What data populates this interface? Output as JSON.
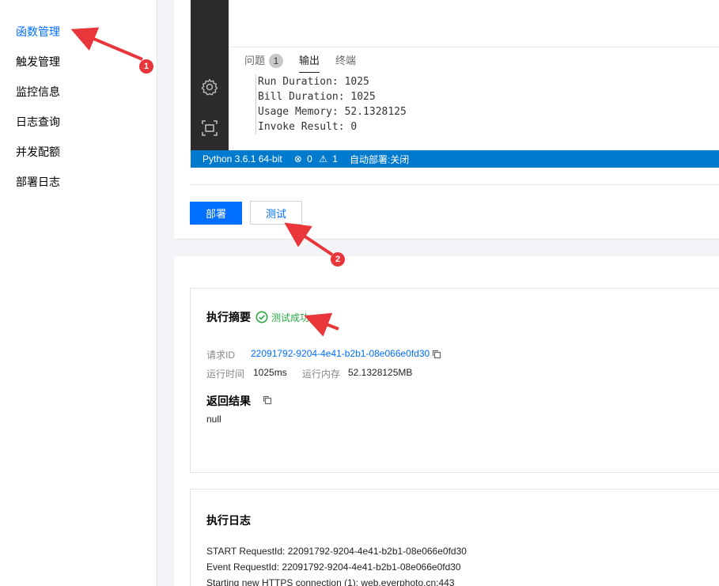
{
  "sidebar": {
    "items": [
      {
        "label": "函数管理",
        "active": true
      },
      {
        "label": "触发管理"
      },
      {
        "label": "监控信息"
      },
      {
        "label": "日志查询"
      },
      {
        "label": "并发配额"
      },
      {
        "label": "部署日志"
      }
    ]
  },
  "editor": {
    "rail_icons": [
      "gear-icon",
      "focus-icon"
    ],
    "panel_tabs": {
      "problems": "问题",
      "problems_count": "1",
      "output": "输出",
      "terminal": "终端"
    },
    "output_lines": [
      "Run Duration: 1025",
      "Bill Duration: 1025",
      "Usage Memory: 52.1328125",
      "Invoke Result: 0"
    ],
    "statusbar": {
      "python": "Python 3.6.1 64-bit",
      "errors_count": "0",
      "warnings_count": "1",
      "autodeploy": "自动部署:关闭"
    }
  },
  "actions": {
    "deploy": "部署",
    "test": "测试"
  },
  "summary": {
    "title": "执行摘要",
    "status": "测试成功",
    "request_id_label": "请求ID",
    "request_id": "22091792-9204-4e41-b2b1-08e066e0fd30",
    "runtime_label": "运行时间",
    "runtime": "1025ms",
    "memory_label": "运行内存",
    "memory": "52.1328125MB",
    "result_title": "返回结果",
    "result": "null"
  },
  "logs": {
    "title": "执行日志",
    "lines": [
      "START RequestId: 22091792-9204-4e41-b2b1-08e066e0fd30",
      "Event RequestId: 22091792-9204-4e41-b2b1-08e066e0fd30",
      "Starting new HTTPS connection (1): web.everphoto.cn:443"
    ]
  },
  "annotations": {
    "marker_1": "1",
    "marker_2": "2"
  },
  "colors": {
    "accent": "#006eff",
    "success": "#29a745",
    "annotation": "#e8363b",
    "statusbar": "#007acc"
  }
}
